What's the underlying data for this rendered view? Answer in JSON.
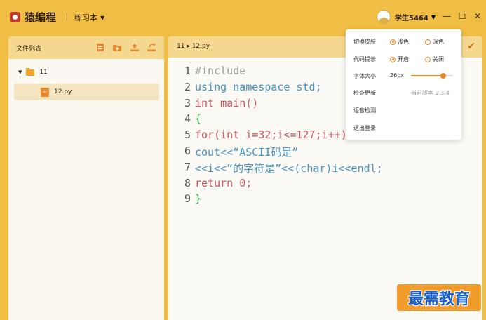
{
  "app": {
    "name": "猿编程",
    "workbook": "练习本",
    "username": "学生5464"
  },
  "file_panel": {
    "title": "文件列表",
    "icons": [
      "new-file-icon",
      "new-folder-icon",
      "upload-icon",
      "export-icon"
    ],
    "tree": {
      "folder": "11",
      "file": "12.py",
      "file_icon_text": "py"
    }
  },
  "editor": {
    "tab_path": "11 ▸ 12.py",
    "line_numbers": [
      "1",
      "2",
      "3",
      "4",
      "5",
      "6",
      "7",
      "8",
      "9"
    ],
    "lines": [
      "#include",
      "using namespace std;",
      "int main()",
      "{",
      "for(int i=32;i<=127;i++)",
      "cout<<“ASCII码是”",
      "<<i<<“的字符是”<<(char)i<<endl;",
      "return 0;",
      "}"
    ]
  },
  "settings_menu": {
    "theme_label": "切换皮肤",
    "theme_light": "浅色",
    "theme_dark": "深色",
    "theme_selected": "浅色",
    "hint_label": "代码提示",
    "hint_on": "开启",
    "hint_off": "关闭",
    "hint_selected": "开启",
    "font_label": "字体大小",
    "font_value": "26px",
    "font_slider_fraction": 0.77,
    "update_label": "检查更新",
    "version_text": "当前版本 2.3.4",
    "voice_label": "语音检测",
    "logout_label": "退出登录"
  },
  "watermark": {
    "text": "最需教育"
  },
  "colors": {
    "accent": "#f0bd45",
    "orange": "#e9872a",
    "keyword": "#4a92c2",
    "type": "#d1505a",
    "brace": "#2a9d47"
  }
}
